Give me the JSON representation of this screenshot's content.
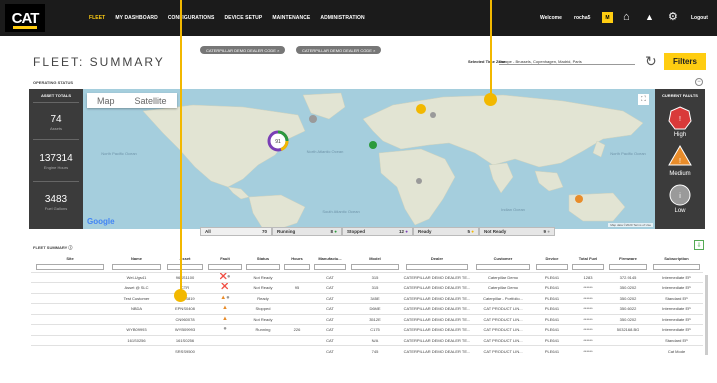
{
  "header": {
    "logo": "CAT",
    "nav": [
      "FLEET",
      "MY DASHBOARD",
      "CONFIGURATIONS",
      "DEVICE SETUP",
      "MAINTENANCE",
      "ADMINISTRATION"
    ],
    "welcome": "Welcome",
    "user": "rocha5",
    "logout": "Logout"
  },
  "page": {
    "title": "FLEET: SUMMARY",
    "filter_pills": [
      "CATERPILLAR DEMO DEALER CODE",
      "CATERPILLAR DEMO DEALER CODE"
    ],
    "timezone_label": "Selected Time Zone:",
    "timezone_value": "Europe - Brussels, Copenhagen, Madrid, Paris",
    "filters_button": "Filters",
    "operating_status": "OPERATING STATUS"
  },
  "asset_totals": {
    "header": "ASSET TOTALS",
    "items": [
      {
        "value": "74",
        "label": "Assets"
      },
      {
        "value": "137314",
        "label": "Engine Hours"
      },
      {
        "value": "3483",
        "label": "Fuel Gallons"
      }
    ]
  },
  "map": {
    "tabs": [
      "Map",
      "Satellite"
    ],
    "selected_tab": "Map",
    "google": "Google",
    "cluster_count": "91",
    "footer": "Map data ©2020   Terms of Use",
    "labels": [
      "North Atlantic Ocean",
      "North Pacific Ocean",
      "Indian Ocean",
      "South Atlantic Ocean",
      "North Pacific Ocean"
    ]
  },
  "current_faults": {
    "header": "CURRENT FAULTS",
    "items": [
      {
        "label": "High",
        "color": "#d93a3a"
      },
      {
        "label": "Medium",
        "color": "#e88c2a"
      },
      {
        "label": "Low",
        "color": "#9a9a9a"
      }
    ]
  },
  "status_bar": [
    {
      "label": "All",
      "count": "70",
      "color": "#dddddd"
    },
    {
      "label": "Running",
      "count": "8",
      "color": "#2c9a3c"
    },
    {
      "label": "Stopped",
      "count": "12",
      "color": "#7a3fb6"
    },
    {
      "label": "Ready",
      "count": "5",
      "color": "#f2b800"
    },
    {
      "label": "Not Ready",
      "count": "9",
      "color": "#9a9a9a"
    }
  ],
  "fleet_summary": {
    "title": "FLEET SUMMARY",
    "columns": [
      "Site",
      "Name",
      "Asset",
      "Fault",
      "Status",
      "Hours",
      "Manufactu...",
      "Model",
      "Dealer",
      "Customer",
      "Device",
      "Total Fuel",
      "Firmware",
      "Subscription"
    ],
    "rows": [
      [
        "",
        "Wel-Ugs41",
        "96SS1100",
        "R,G",
        "Not Ready",
        "",
        "CAT",
        "315",
        "CATERPILLAR DEMO DEALER TE...",
        "Caterpillar Demo",
        "PLE641",
        "1283",
        "372.9145",
        "Intermediate EP"
      ],
      [
        "",
        "Asset @ SLC",
        "CTR",
        "R",
        "Not Ready",
        "95",
        "CAT",
        "315",
        "CATERPILLAR DEMO DEALER TE...",
        "Caterpillar Demo",
        "PLE641",
        "******",
        "350.0202",
        "Intermediate EP"
      ],
      [
        "",
        "Test Customer",
        "TES4S819",
        "O,G",
        "Ready",
        "",
        "CAT",
        "345E",
        "CATERPILLAR DEMO DEALER TE...",
        "Caterpillar - Portfolio...",
        "PLE641",
        "******",
        "350.0202",
        "Standard EP"
      ],
      [
        "",
        "NBDA",
        "EPNS0408",
        "O",
        "Stopped",
        "",
        "CAT",
        "D6ME",
        "CATERPILLAR DEMO DEALER TE...",
        "CAT PRODUCT LIN...",
        "PLE641",
        "******",
        "350.6022",
        "Intermediate EP"
      ],
      [
        "",
        "",
        "CN960078",
        "O",
        "Not Ready",
        "",
        "CAT",
        "3512E",
        "CATERPILLAR DEMO DEALER TE...",
        "CAT PRODUCT LIN...",
        "PLE641",
        "******",
        "350.0202",
        "Intermediate EP"
      ],
      [
        "",
        "WYB09993",
        "WYB09993",
        "G",
        "Running",
        "226",
        "CAT",
        "C175",
        "CATERPILLAR DEMO DEALER TE...",
        "CAT PRODUCT LIN...",
        "PLE641",
        "******",
        "5032168.BG",
        "Intermediate EP"
      ],
      [
        "",
        "161S0256",
        "161S0256",
        "",
        "",
        "",
        "CAT",
        "N/A",
        "CATERPILLAR DEMO DEALER TE...",
        "CAT PRODUCT LIN...",
        "PLE641",
        "******",
        "",
        "Standard EP"
      ],
      [
        "",
        "",
        "SRSS9500",
        "",
        "",
        "",
        "CAT",
        "745",
        "CATERPILLAR DEMO DEALER TE...",
        "CAT PRODUCT LIN...",
        "PLE641",
        "******",
        "",
        "Cat Mode"
      ]
    ]
  }
}
